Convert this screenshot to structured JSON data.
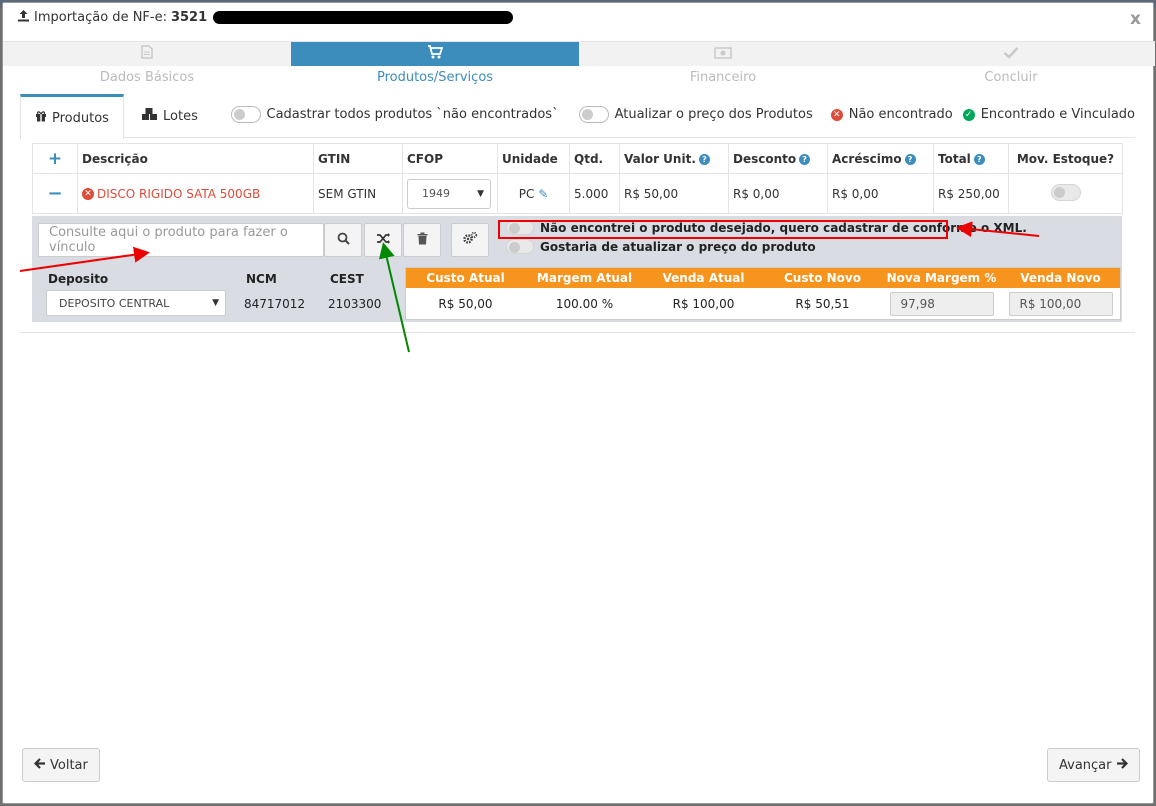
{
  "modal": {
    "title": "Importação de NF-e:",
    "title_code": "3521",
    "close": "x"
  },
  "steps": [
    {
      "label": "Dados Básicos",
      "icon": "file-icon"
    },
    {
      "label": "Produtos/Serviços",
      "icon": "cart-icon"
    },
    {
      "label": "Financeiro",
      "icon": "money-icon"
    },
    {
      "label": "Concluir",
      "icon": "check-icon"
    }
  ],
  "tabs": {
    "produtos": "Produtos",
    "lotes": "Lotes"
  },
  "toggles": {
    "cadastrar_todos": "Cadastrar todos produtos `não encontrados`",
    "atualizar_preco": "Atualizar o preço dos Produtos"
  },
  "legend": {
    "nao_encontrado": "Não encontrado",
    "encontrado": "Encontrado e Vinculado"
  },
  "table": {
    "add": "+",
    "headers": {
      "descricao": "Descrição",
      "gtin": "GTIN",
      "cfop": "CFOP",
      "unidade": "Unidade",
      "qtd": "Qtd.",
      "valor_unit": "Valor Unit.",
      "desconto": "Desconto",
      "acrescimo": "Acréscimo",
      "total": "Total",
      "mov_estoque": "Mov. Estoque?"
    },
    "row": {
      "remove": "−",
      "descricao": "DISCO RIGIDO SATA 500GB",
      "gtin": "SEM GTIN",
      "cfop": "1949",
      "unidade": "PC",
      "qtd": "5.000",
      "valor_unit": "R$ 50,00",
      "desconto": "R$ 0,00",
      "acrescimo": "R$ 0,00",
      "total": "R$ 250,00"
    }
  },
  "search": {
    "placeholder": "Consulte aqui o produto para fazer o vínculo"
  },
  "xml_options": {
    "nao_encontrei": "Não encontrei o produto desejado, quero cadastrar de conforme o XML.",
    "atualizar_preco": "Gostaria de atualizar o preço do produto"
  },
  "deposito": {
    "label": "Deposito",
    "value": "DEPOSITO CENTRAL",
    "ncm_label": "NCM",
    "ncm": "84717012",
    "cest_label": "CEST",
    "cest": "2103300"
  },
  "prices": {
    "headers": [
      "Custo Atual",
      "Margem Atual",
      "Venda Atual",
      "Custo Novo",
      "Nova Margem %",
      "Venda Novo"
    ],
    "custo_atual": "R$ 50,00",
    "margem_atual": "100.00 %",
    "venda_atual": "R$ 100,00",
    "custo_novo": "R$ 50,51",
    "nova_margem": "97,98",
    "venda_novo": "R$ 100,00"
  },
  "footer": {
    "voltar": "Voltar",
    "avancar": "Avançar"
  },
  "colors": {
    "primary": "#3c8dbc",
    "orange": "#f7941d",
    "danger": "#dd4b39",
    "success": "#00a65a",
    "annotation_red": "#e00000",
    "annotation_green": "#008000"
  }
}
